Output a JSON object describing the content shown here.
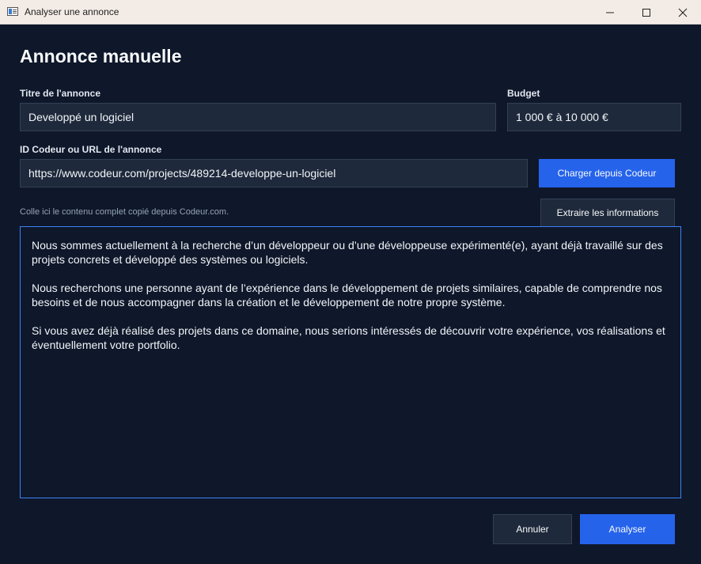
{
  "window": {
    "title": "Analyser une annonce"
  },
  "heading": "Annonce manuelle",
  "title_field": {
    "label": "Titre de l'annonce",
    "value": "Developpé un logiciel"
  },
  "budget_field": {
    "label": "Budget",
    "value": "1 000 € à 10 000 €"
  },
  "url_field": {
    "label": "ID Codeur ou URL de l'annonce",
    "value": "https://www.codeur.com/projects/489214-developpe-un-logiciel"
  },
  "buttons": {
    "load": "Charger depuis Codeur",
    "extract": "Extraire les informations",
    "cancel": "Annuler",
    "analyze": "Analyser"
  },
  "hint": "Colle ici le contenu complet copié depuis Codeur.com.",
  "content": {
    "paragraphs": [
      "Nous sommes actuellement à la recherche d’un développeur ou d’une développeuse expérimenté(e), ayant déjà travaillé sur des projets concrets et développé des systèmes ou logiciels.",
      "Nous recherchons une personne ayant de l’expérience dans le développement de projets similaires, capable de comprendre nos besoins et de nous accompagner dans la création et le développement de notre propre système.",
      "Si vous avez déjà réalisé des projets dans ce domaine, nous serions intéressés de découvrir votre expérience, vos réalisations et éventuellement votre portfolio."
    ]
  },
  "colors": {
    "background": "#0f172a",
    "field_bg": "#1e293b",
    "accent": "#2563eb",
    "focus_border": "#3b82f6"
  },
  "icons": [
    "app-icon",
    "minimize-icon",
    "maximize-icon",
    "close-icon"
  ]
}
